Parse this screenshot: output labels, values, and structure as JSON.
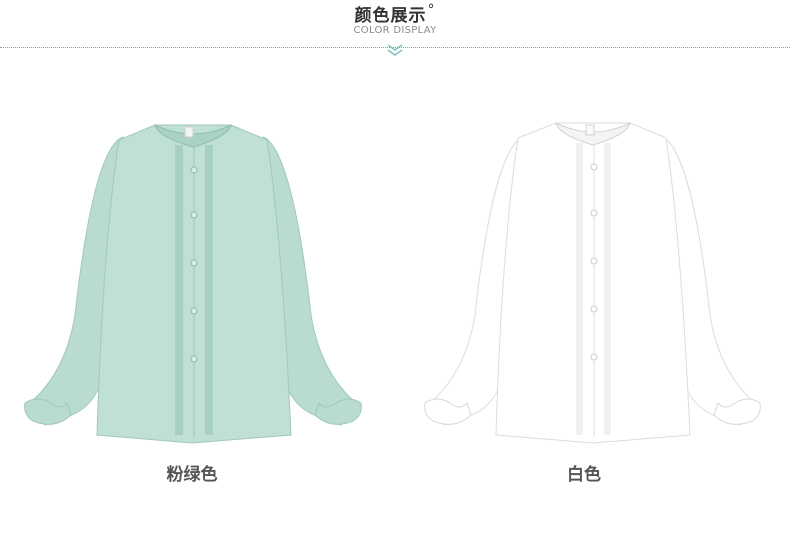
{
  "header": {
    "title": "颜色展示",
    "title_mark": "°",
    "subtitle": "COLOR DISPLAY"
  },
  "products": [
    {
      "color_name": "粉绿色",
      "swatch": "#b9dccf",
      "shade": "#9fc9b9"
    },
    {
      "color_name": "白色",
      "swatch": "#ffffff",
      "shade": "#e6e6e6"
    }
  ],
  "colors": {
    "accent": "#7ec4c0",
    "divider": "#9a9a9a",
    "title": "#333333",
    "label": "#555555"
  }
}
